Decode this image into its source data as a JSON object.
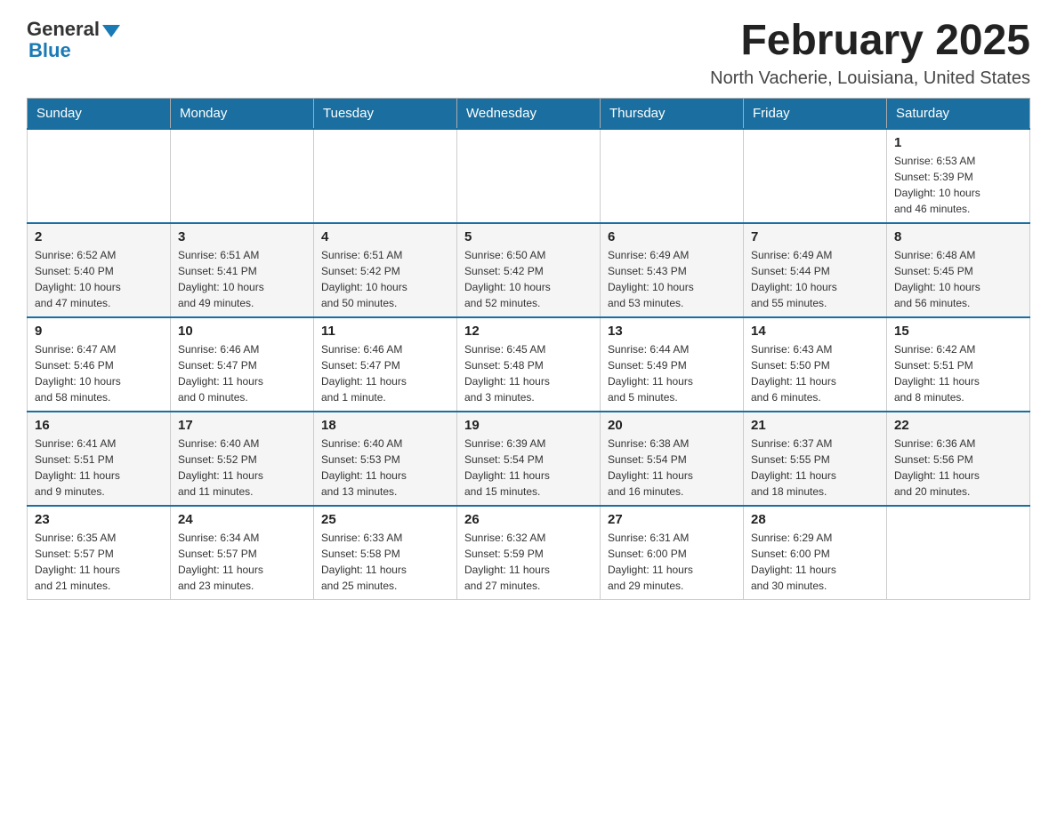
{
  "header": {
    "logo_general": "General",
    "logo_blue": "Blue",
    "month_title": "February 2025",
    "location": "North Vacherie, Louisiana, United States"
  },
  "days_of_week": [
    "Sunday",
    "Monday",
    "Tuesday",
    "Wednesday",
    "Thursday",
    "Friday",
    "Saturday"
  ],
  "weeks": [
    [
      {
        "day": "",
        "info": ""
      },
      {
        "day": "",
        "info": ""
      },
      {
        "day": "",
        "info": ""
      },
      {
        "day": "",
        "info": ""
      },
      {
        "day": "",
        "info": ""
      },
      {
        "day": "",
        "info": ""
      },
      {
        "day": "1",
        "info": "Sunrise: 6:53 AM\nSunset: 5:39 PM\nDaylight: 10 hours\nand 46 minutes."
      }
    ],
    [
      {
        "day": "2",
        "info": "Sunrise: 6:52 AM\nSunset: 5:40 PM\nDaylight: 10 hours\nand 47 minutes."
      },
      {
        "day": "3",
        "info": "Sunrise: 6:51 AM\nSunset: 5:41 PM\nDaylight: 10 hours\nand 49 minutes."
      },
      {
        "day": "4",
        "info": "Sunrise: 6:51 AM\nSunset: 5:42 PM\nDaylight: 10 hours\nand 50 minutes."
      },
      {
        "day": "5",
        "info": "Sunrise: 6:50 AM\nSunset: 5:42 PM\nDaylight: 10 hours\nand 52 minutes."
      },
      {
        "day": "6",
        "info": "Sunrise: 6:49 AM\nSunset: 5:43 PM\nDaylight: 10 hours\nand 53 minutes."
      },
      {
        "day": "7",
        "info": "Sunrise: 6:49 AM\nSunset: 5:44 PM\nDaylight: 10 hours\nand 55 minutes."
      },
      {
        "day": "8",
        "info": "Sunrise: 6:48 AM\nSunset: 5:45 PM\nDaylight: 10 hours\nand 56 minutes."
      }
    ],
    [
      {
        "day": "9",
        "info": "Sunrise: 6:47 AM\nSunset: 5:46 PM\nDaylight: 10 hours\nand 58 minutes."
      },
      {
        "day": "10",
        "info": "Sunrise: 6:46 AM\nSunset: 5:47 PM\nDaylight: 11 hours\nand 0 minutes."
      },
      {
        "day": "11",
        "info": "Sunrise: 6:46 AM\nSunset: 5:47 PM\nDaylight: 11 hours\nand 1 minute."
      },
      {
        "day": "12",
        "info": "Sunrise: 6:45 AM\nSunset: 5:48 PM\nDaylight: 11 hours\nand 3 minutes."
      },
      {
        "day": "13",
        "info": "Sunrise: 6:44 AM\nSunset: 5:49 PM\nDaylight: 11 hours\nand 5 minutes."
      },
      {
        "day": "14",
        "info": "Sunrise: 6:43 AM\nSunset: 5:50 PM\nDaylight: 11 hours\nand 6 minutes."
      },
      {
        "day": "15",
        "info": "Sunrise: 6:42 AM\nSunset: 5:51 PM\nDaylight: 11 hours\nand 8 minutes."
      }
    ],
    [
      {
        "day": "16",
        "info": "Sunrise: 6:41 AM\nSunset: 5:51 PM\nDaylight: 11 hours\nand 9 minutes."
      },
      {
        "day": "17",
        "info": "Sunrise: 6:40 AM\nSunset: 5:52 PM\nDaylight: 11 hours\nand 11 minutes."
      },
      {
        "day": "18",
        "info": "Sunrise: 6:40 AM\nSunset: 5:53 PM\nDaylight: 11 hours\nand 13 minutes."
      },
      {
        "day": "19",
        "info": "Sunrise: 6:39 AM\nSunset: 5:54 PM\nDaylight: 11 hours\nand 15 minutes."
      },
      {
        "day": "20",
        "info": "Sunrise: 6:38 AM\nSunset: 5:54 PM\nDaylight: 11 hours\nand 16 minutes."
      },
      {
        "day": "21",
        "info": "Sunrise: 6:37 AM\nSunset: 5:55 PM\nDaylight: 11 hours\nand 18 minutes."
      },
      {
        "day": "22",
        "info": "Sunrise: 6:36 AM\nSunset: 5:56 PM\nDaylight: 11 hours\nand 20 minutes."
      }
    ],
    [
      {
        "day": "23",
        "info": "Sunrise: 6:35 AM\nSunset: 5:57 PM\nDaylight: 11 hours\nand 21 minutes."
      },
      {
        "day": "24",
        "info": "Sunrise: 6:34 AM\nSunset: 5:57 PM\nDaylight: 11 hours\nand 23 minutes."
      },
      {
        "day": "25",
        "info": "Sunrise: 6:33 AM\nSunset: 5:58 PM\nDaylight: 11 hours\nand 25 minutes."
      },
      {
        "day": "26",
        "info": "Sunrise: 6:32 AM\nSunset: 5:59 PM\nDaylight: 11 hours\nand 27 minutes."
      },
      {
        "day": "27",
        "info": "Sunrise: 6:31 AM\nSunset: 6:00 PM\nDaylight: 11 hours\nand 29 minutes."
      },
      {
        "day": "28",
        "info": "Sunrise: 6:29 AM\nSunset: 6:00 PM\nDaylight: 11 hours\nand 30 minutes."
      },
      {
        "day": "",
        "info": ""
      }
    ]
  ]
}
